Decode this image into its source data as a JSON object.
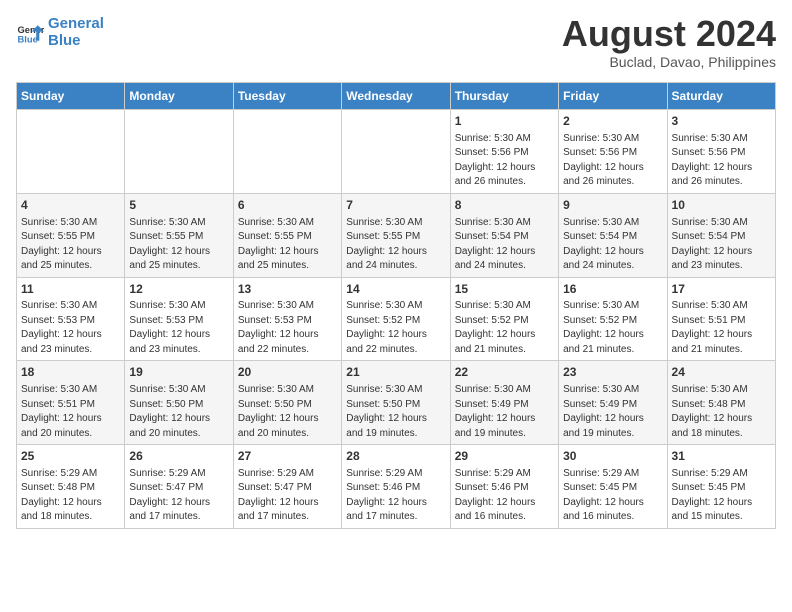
{
  "header": {
    "logo_line1": "General",
    "logo_line2": "Blue",
    "month_year": "August 2024",
    "location": "Buclad, Davao, Philippines"
  },
  "weekdays": [
    "Sunday",
    "Monday",
    "Tuesday",
    "Wednesday",
    "Thursday",
    "Friday",
    "Saturday"
  ],
  "weeks": [
    [
      {
        "day": "",
        "info": ""
      },
      {
        "day": "",
        "info": ""
      },
      {
        "day": "",
        "info": ""
      },
      {
        "day": "",
        "info": ""
      },
      {
        "day": "1",
        "info": "Sunrise: 5:30 AM\nSunset: 5:56 PM\nDaylight: 12 hours\nand 26 minutes."
      },
      {
        "day": "2",
        "info": "Sunrise: 5:30 AM\nSunset: 5:56 PM\nDaylight: 12 hours\nand 26 minutes."
      },
      {
        "day": "3",
        "info": "Sunrise: 5:30 AM\nSunset: 5:56 PM\nDaylight: 12 hours\nand 26 minutes."
      }
    ],
    [
      {
        "day": "4",
        "info": "Sunrise: 5:30 AM\nSunset: 5:55 PM\nDaylight: 12 hours\nand 25 minutes."
      },
      {
        "day": "5",
        "info": "Sunrise: 5:30 AM\nSunset: 5:55 PM\nDaylight: 12 hours\nand 25 minutes."
      },
      {
        "day": "6",
        "info": "Sunrise: 5:30 AM\nSunset: 5:55 PM\nDaylight: 12 hours\nand 25 minutes."
      },
      {
        "day": "7",
        "info": "Sunrise: 5:30 AM\nSunset: 5:55 PM\nDaylight: 12 hours\nand 24 minutes."
      },
      {
        "day": "8",
        "info": "Sunrise: 5:30 AM\nSunset: 5:54 PM\nDaylight: 12 hours\nand 24 minutes."
      },
      {
        "day": "9",
        "info": "Sunrise: 5:30 AM\nSunset: 5:54 PM\nDaylight: 12 hours\nand 24 minutes."
      },
      {
        "day": "10",
        "info": "Sunrise: 5:30 AM\nSunset: 5:54 PM\nDaylight: 12 hours\nand 23 minutes."
      }
    ],
    [
      {
        "day": "11",
        "info": "Sunrise: 5:30 AM\nSunset: 5:53 PM\nDaylight: 12 hours\nand 23 minutes."
      },
      {
        "day": "12",
        "info": "Sunrise: 5:30 AM\nSunset: 5:53 PM\nDaylight: 12 hours\nand 23 minutes."
      },
      {
        "day": "13",
        "info": "Sunrise: 5:30 AM\nSunset: 5:53 PM\nDaylight: 12 hours\nand 22 minutes."
      },
      {
        "day": "14",
        "info": "Sunrise: 5:30 AM\nSunset: 5:52 PM\nDaylight: 12 hours\nand 22 minutes."
      },
      {
        "day": "15",
        "info": "Sunrise: 5:30 AM\nSunset: 5:52 PM\nDaylight: 12 hours\nand 21 minutes."
      },
      {
        "day": "16",
        "info": "Sunrise: 5:30 AM\nSunset: 5:52 PM\nDaylight: 12 hours\nand 21 minutes."
      },
      {
        "day": "17",
        "info": "Sunrise: 5:30 AM\nSunset: 5:51 PM\nDaylight: 12 hours\nand 21 minutes."
      }
    ],
    [
      {
        "day": "18",
        "info": "Sunrise: 5:30 AM\nSunset: 5:51 PM\nDaylight: 12 hours\nand 20 minutes."
      },
      {
        "day": "19",
        "info": "Sunrise: 5:30 AM\nSunset: 5:50 PM\nDaylight: 12 hours\nand 20 minutes."
      },
      {
        "day": "20",
        "info": "Sunrise: 5:30 AM\nSunset: 5:50 PM\nDaylight: 12 hours\nand 20 minutes."
      },
      {
        "day": "21",
        "info": "Sunrise: 5:30 AM\nSunset: 5:50 PM\nDaylight: 12 hours\nand 19 minutes."
      },
      {
        "day": "22",
        "info": "Sunrise: 5:30 AM\nSunset: 5:49 PM\nDaylight: 12 hours\nand 19 minutes."
      },
      {
        "day": "23",
        "info": "Sunrise: 5:30 AM\nSunset: 5:49 PM\nDaylight: 12 hours\nand 19 minutes."
      },
      {
        "day": "24",
        "info": "Sunrise: 5:30 AM\nSunset: 5:48 PM\nDaylight: 12 hours\nand 18 minutes."
      }
    ],
    [
      {
        "day": "25",
        "info": "Sunrise: 5:29 AM\nSunset: 5:48 PM\nDaylight: 12 hours\nand 18 minutes."
      },
      {
        "day": "26",
        "info": "Sunrise: 5:29 AM\nSunset: 5:47 PM\nDaylight: 12 hours\nand 17 minutes."
      },
      {
        "day": "27",
        "info": "Sunrise: 5:29 AM\nSunset: 5:47 PM\nDaylight: 12 hours\nand 17 minutes."
      },
      {
        "day": "28",
        "info": "Sunrise: 5:29 AM\nSunset: 5:46 PM\nDaylight: 12 hours\nand 17 minutes."
      },
      {
        "day": "29",
        "info": "Sunrise: 5:29 AM\nSunset: 5:46 PM\nDaylight: 12 hours\nand 16 minutes."
      },
      {
        "day": "30",
        "info": "Sunrise: 5:29 AM\nSunset: 5:45 PM\nDaylight: 12 hours\nand 16 minutes."
      },
      {
        "day": "31",
        "info": "Sunrise: 5:29 AM\nSunset: 5:45 PM\nDaylight: 12 hours\nand 15 minutes."
      }
    ]
  ]
}
